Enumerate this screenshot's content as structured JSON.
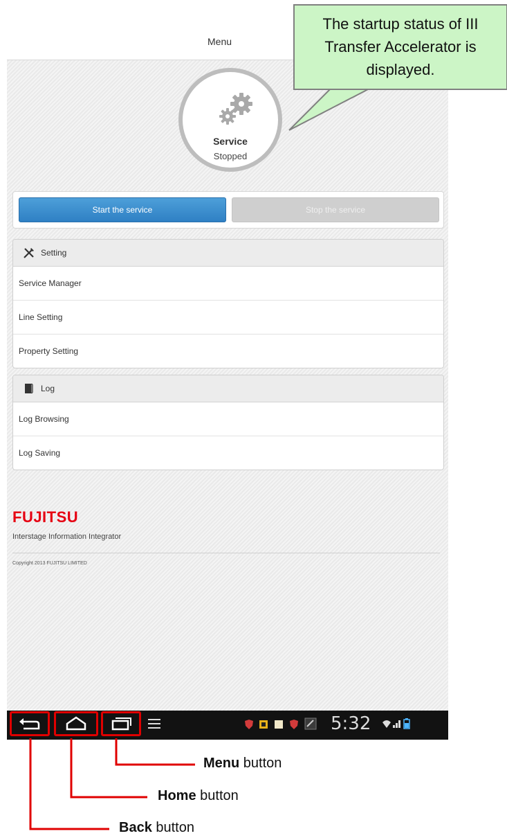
{
  "header": {
    "title": "Menu"
  },
  "status": {
    "service_label": "Service",
    "state": "Stopped"
  },
  "actions": {
    "start_label": "Start the service",
    "stop_label": "Stop  the service"
  },
  "sections": [
    {
      "title": "Setting",
      "icon": "tools-icon",
      "items": [
        "Service Manager",
        "Line Setting",
        "Property Setting"
      ]
    },
    {
      "title": "Log",
      "icon": "log-book-icon",
      "items": [
        "Log Browsing",
        "Log Saving"
      ]
    }
  ],
  "footer": {
    "logo": "FUJITSU",
    "product": "Interstage Information Integrator",
    "copyright": "Copyright 2013 FUJITSU LIMITED"
  },
  "statusbar": {
    "time": "5:32"
  },
  "callout": {
    "line1": "The startup status of III",
    "line2": "Transfer Accelerator is",
    "line3": "displayed."
  },
  "annotations": {
    "menu": {
      "bold": "Menu",
      "rest": " button"
    },
    "home": {
      "bold": "Home",
      "rest": " button"
    },
    "back": {
      "bold": "Back",
      "rest": " button"
    }
  },
  "colors": {
    "accent_blue": "#2f80c4",
    "highlight_red": "#e00000",
    "callout_green": "#ccf5c6",
    "brand_red": "#e60012"
  }
}
